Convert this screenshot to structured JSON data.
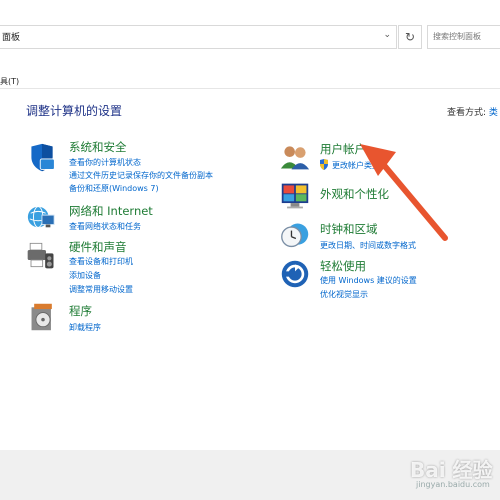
{
  "address": {
    "path": "面板",
    "chevron": "⌄"
  },
  "refresh_glyph": "↻",
  "search": {
    "placeholder": "搜索控制面板"
  },
  "menu": {
    "tools": "具(T)"
  },
  "main": {
    "title": "调整计算机的设置",
    "view_by_label": "查看方式:",
    "view_by_value": "类"
  },
  "categories_left": [
    {
      "title": "系统和安全",
      "icon": "shield-icon",
      "links": [
        "查看你的计算机状态",
        "通过文件历史记录保存你的文件备份副本",
        "备份和还原(Windows 7)"
      ]
    },
    {
      "title": "网络和 Internet",
      "icon": "network-globe-icon",
      "links": [
        "查看网络状态和任务"
      ]
    },
    {
      "title": "硬件和声音",
      "icon": "printer-icon",
      "links": [
        "查看设备和打印机",
        "添加设备",
        "调整常用移动设置"
      ]
    },
    {
      "title": "程序",
      "icon": "programs-disc-icon",
      "links": [
        "卸载程序"
      ]
    }
  ],
  "categories_right": [
    {
      "title": "用户帐户",
      "icon": "users-icon",
      "links": [
        "更改帐户类型"
      ]
    },
    {
      "title": "外观和个性化",
      "icon": "monitor-palette-icon",
      "links": []
    },
    {
      "title": "时钟和区域",
      "icon": "clock-globe-icon",
      "links": [
        "更改日期、时间或数字格式"
      ]
    },
    {
      "title": "轻松使用",
      "icon": "ease-of-access-icon",
      "links": [
        "使用 Windows 建议的设置",
        "优化视觉显示"
      ]
    }
  ],
  "watermark": {
    "logo": "Bai 经验",
    "url": "jingyan.baidu.com"
  },
  "colors": {
    "category_green": "#1e7b34",
    "link_blue": "#0066cc",
    "title_navy": "#1e3287",
    "arrow_orange": "#e8552f"
  }
}
